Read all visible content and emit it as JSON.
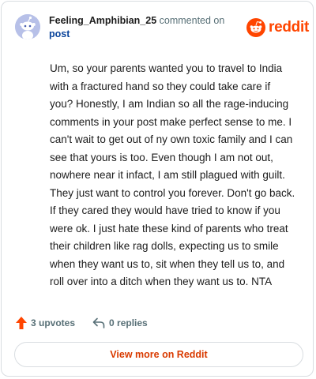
{
  "header": {
    "username": "Feeling_Amphibian_25",
    "action_text": "commented on",
    "post_link": "post",
    "brand_name": "reddit"
  },
  "comment": {
    "text": "Um, so your parents wanted you to travel to India with a fractured hand so they could take care if you? Honestly, I am Indian so all the rage-inducing comments in your post make perfect sense to me. I can't wait to get out of ny own toxic family and I can see that yours is too. Even though I am not out, nowhere near it infact, I am still plagued with guilt. They just want to control you forever. Don't go back. If they cared they would have tried to know if you were ok. I just hate these kind of parents who treat their children like rag dolls, expecting us to smile when they want us to, sit when they tell us to, and roll over into a ditch when they want us to. NTA"
  },
  "actions": {
    "upvotes": "3 upvotes",
    "replies": "0 replies"
  },
  "footer": {
    "view_more_label": "View more on Reddit"
  },
  "colors": {
    "brand": "#ff4500",
    "link": "#0a449b",
    "view_more": "#d93a00",
    "muted": "#576f76",
    "avatar_bg": "#b7c0e8"
  },
  "icons": {
    "avatar": "snoo-avatar-icon",
    "brand": "reddit-logo-icon",
    "upvote": "upvote-arrow-icon",
    "reply": "reply-arrow-icon"
  }
}
